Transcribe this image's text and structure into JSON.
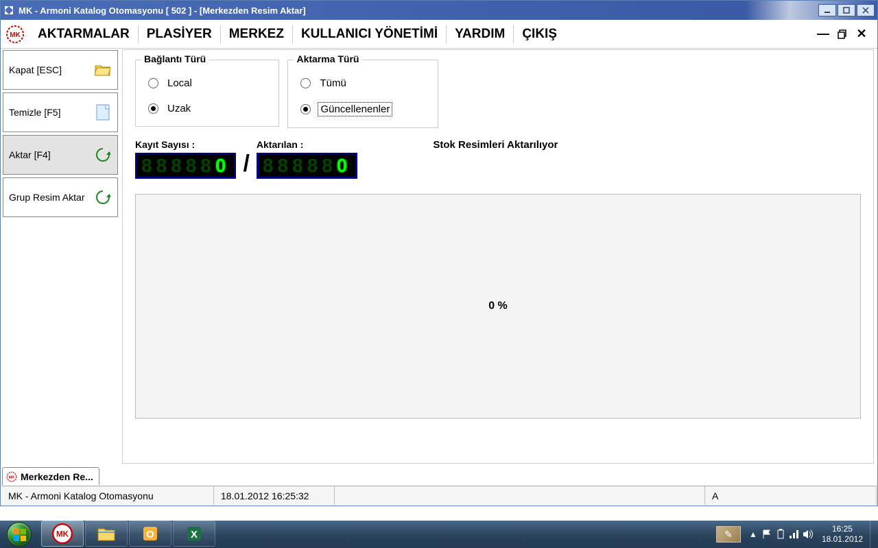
{
  "titlebar": {
    "text": "MK - Armoni Katalog Otomasyonu [ 502 ]  - [Merkezden Resim Aktar]"
  },
  "menu": {
    "items": [
      "AKTARMALAR",
      "PLASİYER",
      "MERKEZ",
      "KULLANICI YÖNETİMİ",
      "YARDIM",
      "ÇIKIŞ"
    ],
    "active_index": 0
  },
  "sidebar": {
    "buttons": [
      {
        "label": "Kapat [ESC]",
        "icon": "folder-open-icon"
      },
      {
        "label": "Temizle [F5]",
        "icon": "page-icon"
      },
      {
        "label": "Aktar [F4]",
        "icon": "refresh-icon",
        "selected": true
      },
      {
        "label": "Grup Resim Aktar",
        "icon": "refresh-icon"
      }
    ]
  },
  "groups": {
    "connection": {
      "legend": "Bağlantı Türü",
      "options": [
        {
          "label": "Local",
          "checked": false
        },
        {
          "label": "Uzak",
          "checked": true
        }
      ]
    },
    "transfer": {
      "legend": "Aktarma Türü",
      "options": [
        {
          "label": "Tümü",
          "checked": false
        },
        {
          "label": "Güncellenenler",
          "checked": true,
          "focused": true
        }
      ]
    }
  },
  "counters": {
    "record_count_label": "Kayıt Sayısı :",
    "record_count_value": "0",
    "transferred_label": "Aktarılan :",
    "transferred_value": "0",
    "status": "Stok Resimleri Aktarılıyor"
  },
  "progress": {
    "percent_text": "0 %"
  },
  "mdi_tab": {
    "label": "Merkezden Re..."
  },
  "statusbar": {
    "app": "MK - Armoni Katalog Otomasyonu",
    "datetime": "18.01.2012 16:25:32",
    "user": "A"
  },
  "taskbar": {
    "clock_time": "16:25",
    "clock_date": "18.01.2012"
  }
}
